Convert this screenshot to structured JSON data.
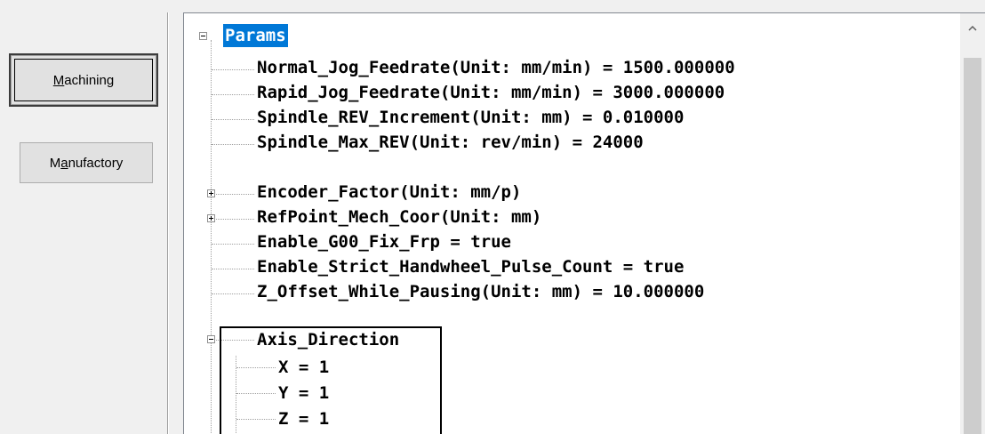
{
  "left_panel": {
    "buttons": {
      "machining": {
        "pre": "",
        "mnemonic": "M",
        "post": "achining"
      },
      "manufactory": {
        "pre": "M",
        "mnemonic": "a",
        "post": "nufactory"
      }
    }
  },
  "tree": {
    "root": "Params",
    "items": [
      "Normal_Jog_Feedrate(Unit: mm/min) = 1500.000000",
      "Rapid_Jog_Feedrate(Unit: mm/min) = 3000.000000",
      "Spindle_REV_Increment(Unit: mm) = 0.010000",
      "Spindle_Max_REV(Unit: rev/min) = 24000",
      "Encoder_Factor(Unit: mm/p)",
      "RefPoint_Mech_Coor(Unit: mm)",
      "Enable_G00_Fix_Frp = true",
      "Enable_Strict_Handwheel_Pulse_Count = true",
      "Z_Offset_While_Pausing(Unit: mm) = 10.000000",
      "Axis_Direction"
    ],
    "axis_children": [
      "X = 1",
      "Y = 1",
      "Z = 1"
    ]
  },
  "colors": {
    "selection": "#0078d7",
    "background": "#f0f0f0"
  },
  "icons": [
    "expand-plus-icon",
    "collapse-minus-icon",
    "scroll-up-arrow-icon"
  ]
}
